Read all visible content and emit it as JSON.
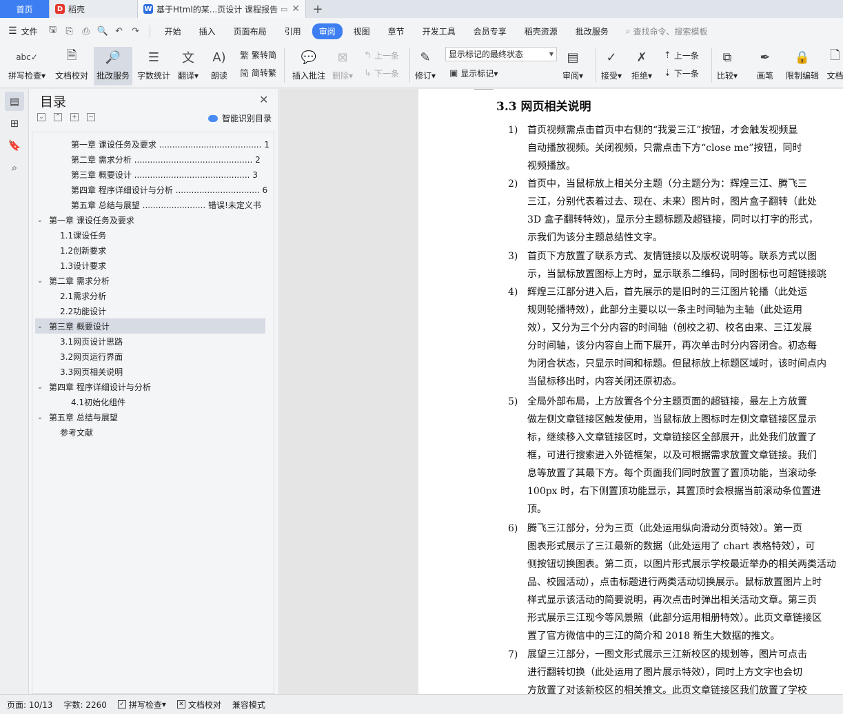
{
  "tabs": [
    {
      "label": "首页"
    },
    {
      "label": "稻壳",
      "icon": "daoke-logo-icon"
    },
    {
      "label": "基于Html的某...页设计 课程报告",
      "icon": "wps-writer-icon"
    }
  ],
  "menu": {
    "file": "文件",
    "items": [
      "开始",
      "插入",
      "页面布局",
      "引用",
      "审阅",
      "视图",
      "章节",
      "开发工具",
      "会员专享",
      "稻壳资源",
      "批改服务"
    ],
    "active": "审阅",
    "search_placeholder": "查找命令、搜索模板"
  },
  "ribbon": {
    "spell_check": "拼写检查",
    "doc_proof": "文档校对",
    "correction_service": "批改服务",
    "word_count": "字数统计",
    "translate": "翻译",
    "read_aloud": "朗读",
    "to_traditional": "繁转简",
    "to_simplified": "简转繁",
    "insert_comment": "插入批注",
    "delete": "删除",
    "prev_comment": "上一条",
    "next_comment": "下一条",
    "revise": "修订",
    "markup_option": "显示标记的最终状态",
    "show_markup": "显示标记",
    "review": "审阅",
    "accept": "接受",
    "reject": "拒绝",
    "prev_change": "上一条",
    "next_change": "下一条",
    "compare": "比较",
    "pen": "画笔",
    "restrict_edit": "限制编辑",
    "doc_auth": "文档"
  },
  "toc": {
    "title": "目录",
    "smart_label": "智能识别目录",
    "rows": [
      {
        "text": "第一章 课设任务及要求 ....................................... 1"
      },
      {
        "text": "第二章 需求分析 ............................................. 2"
      },
      {
        "text": "第三章 概要设计 ............................................ 3"
      },
      {
        "text": "第四章 程序详细设计与分析 ................................ 6"
      },
      {
        "text": "第五章  总结与展望 ........................ 错误!未定义书 ..."
      },
      {
        "text": "第一章 课设任务及要求"
      },
      {
        "text": "1.1课设任务"
      },
      {
        "text": "1.2创新要求"
      },
      {
        "text": "1.3设计要求"
      },
      {
        "text": "第二章 需求分析"
      },
      {
        "text": "2.1需求分析"
      },
      {
        "text": "2.2功能设计"
      },
      {
        "text": "第三章 概要设计"
      },
      {
        "text": "3.1网页设计思路"
      },
      {
        "text": "3.2网页运行界面"
      },
      {
        "text": "3.3网页相关说明"
      },
      {
        "text": "第四章 程序详细设计与分析"
      },
      {
        "text": "4.1初始化组件"
      },
      {
        "text": "第五章 总结与展望"
      },
      {
        "text": "参考文献"
      }
    ]
  },
  "document": {
    "heading": "3.3  网页相关说明",
    "paragraphs": [
      {
        "num": "1)",
        "lines": [
          "首页视频需点击首页中右侧的“我爱三江”按钮，才会触发视频显",
          "自动播放视频。关闭视频，只需点击下方“close me”按钮，同时",
          "视频播放。"
        ]
      },
      {
        "num": "2)",
        "lines": [
          "首页中，当鼠标放上相关分主题（分主题分为：辉煌三江、腾飞三",
          "三江，分别代表着过去、现在、未来）图片时，图片盒子翻转（此处",
          "3D 盒子翻转特效)，显示分主题标题及超链接，同时以打字的形式，",
          "示我们为该分主题总结性文字。"
        ]
      },
      {
        "num": "3)",
        "lines": [
          "首页下方放置了联系方式、友情链接以及版权说明等。联系方式以图",
          "示，当鼠标放置图标上方时，显示联系二维码，同时图标也可超链接跳"
        ]
      },
      {
        "num": "4)",
        "lines": [
          "辉煌三江部分进入后，首先展示的是旧时的三江图片轮播（此处运",
          "规则轮播特效），此部分主要以以一条主时间轴为主轴（此处运用",
          "效），又分为三个分内容的时间轴（创校之初、校名由来、三江发展",
          "分时间轴，该分内容自上而下展开，再次单击时分内容闭合。初态每",
          "为闭合状态，只显示时间和标题。但鼠标放上标题区域时，该时间点内",
          "当鼠标移出时，内容关闭还原初态。"
        ]
      },
      {
        "num": "5)",
        "lines": [
          "全局外部布局，上方放置各个分主题页面的超链接，最左上方放置",
          "做左侧文章链接区触发使用，当鼠标放上图标时左侧文章链接区显示",
          "标，继续移入文章链接区时，文章链接区全部展开，此处我们放置了",
          "框，可进行搜索进入外链框架，以及可根据需求放置文章链接。我们",
          "息等放置了其最下方。每个页面我们同时放置了置顶功能，当滚动条",
          "100px 时，右下侧置顶功能显示，其置顶时会根据当前滚动条位置进",
          "顶。"
        ]
      },
      {
        "num": "6)",
        "lines": [
          "腾飞三江部分，分为三页（此处运用纵向滑动分页特效）。第一页",
          "图表形式展示了三江最新的数据（此处运用了  chart 表格特效），可",
          "侧按钮切换图表。第二页，以图片形式展示学校最近举办的相关两类活动",
          "品、校园活动），点击标题进行两类活动切换展示。鼠标放置图片上时",
          "样式显示该活动的简要说明，再次点击时弹出相关活动文章。第三页",
          "形式展示三江现今等风景照（此部分运用相册特效）。此页文章链接区",
          "置了官方微信中的三江的简介和  2018 新生大数据的推文。"
        ]
      },
      {
        "num": "7)",
        "lines": [
          "展望三江部分，一图文形式展示三江新校区的规划等，图片可点击",
          "进行翻转切换（此处运用了图片展示特效），同时上方文字也会切",
          "方放置了对该新校区的相关推文。此页文章链接区我们放置了学校"
        ]
      }
    ]
  },
  "status": {
    "page": "页面: 10/13",
    "words": "字数: 2260",
    "spell": "拼写检查",
    "proof": "文档校对",
    "compat": "兼容模式"
  },
  "colors": {
    "accent": "#3d7ff2",
    "tab_home_bg": "#3d7ff2",
    "wps_red": "#e5352c"
  }
}
